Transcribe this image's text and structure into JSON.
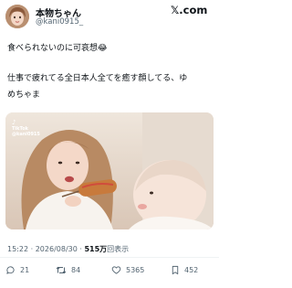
{
  "user": {
    "display_name": "本物ちゃん",
    "handle": "@kani0915_"
  },
  "brand": {
    "logo_text": "𝕏.com"
  },
  "tweet": {
    "line1": "食べられないのに可哀想😂",
    "line2": "仕事で疲れてる全日本人全てを癒す顔してる、ゆ",
    "line3": "めちゃま"
  },
  "media": {
    "watermark_app": "TikTok",
    "watermark_user": "@kani0915"
  },
  "meta": {
    "time": "15:22",
    "sep1": "·",
    "date": "2026/08/30",
    "sep2": "·",
    "views_count": "515万",
    "views_label": "回表示"
  },
  "actions": {
    "replies": "21",
    "reposts": "84",
    "likes": "5365",
    "bookmarks": "452"
  },
  "colors": {
    "text": "#0f1419",
    "muted": "#536471",
    "divider": "#eff3f4"
  }
}
